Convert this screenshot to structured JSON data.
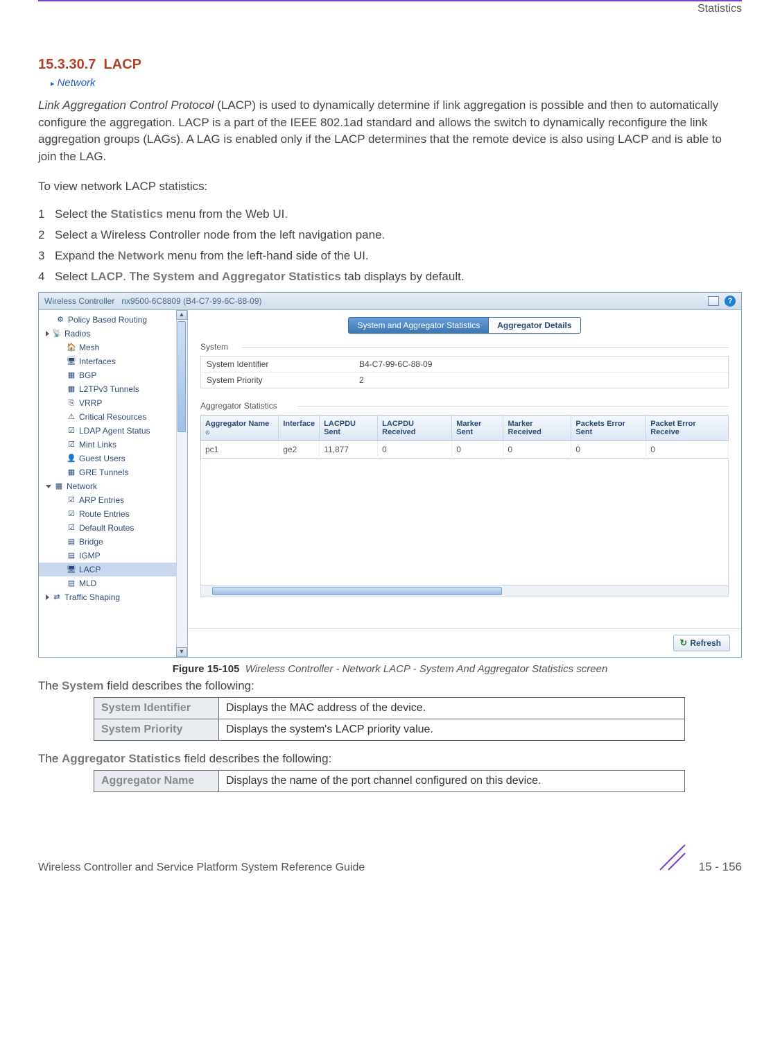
{
  "header": {
    "right": "Statistics"
  },
  "section": {
    "number": "15.3.30.7",
    "title": "LACP",
    "breadcrumb": "Network"
  },
  "intro": {
    "lead_italic": "Link Aggregation Control Protocol",
    "para": " (LACP) is used to dynamically determine if link aggregation is possible and then to automatically configure the aggregation. LACP is a part of the IEEE 802.1ad standard and allows the switch to dynamically reconfigure the link aggregation groups (LAGs). A LAG is enabled only if the LACP determines that the remote device is also using LACP and is able to join the LAG.",
    "to_view": "To view network LACP statistics:"
  },
  "steps": {
    "s1a": "Select the ",
    "s1b": "Statistics",
    "s1c": " menu from the Web UI.",
    "s2": "Select a Wireless Controller node from the left navigation pane.",
    "s3a": "Expand the ",
    "s3b": "Network",
    "s3c": " menu from the left-hand side of the UI.",
    "s4a": "Select ",
    "s4b": "LACP",
    "s4c": ". The ",
    "s4d": "System and Aggregator Statistics",
    "s4e": " tab displays by default."
  },
  "screenshot": {
    "titlebar": {
      "prefix": "Wireless Controller",
      "node": "nx9500-6C8809 (B4-C7-99-6C-88-09)"
    },
    "nav": {
      "items": [
        {
          "t": "Policy Based Routing",
          "ico": "⚙",
          "indent": false
        },
        {
          "t": "Radios",
          "ico": "📡",
          "indent": false,
          "arrow": "right"
        },
        {
          "t": "Mesh",
          "ico": "🏠",
          "indent": true
        },
        {
          "t": "Interfaces",
          "ico": "🖥",
          "indent": true
        },
        {
          "t": "BGP",
          "ico": "▦",
          "indent": true
        },
        {
          "t": "L2TPv3 Tunnels",
          "ico": "▦",
          "indent": true
        },
        {
          "t": "VRRP",
          "ico": "⎘",
          "indent": true
        },
        {
          "t": "Critical Resources",
          "ico": "⚠",
          "indent": true
        },
        {
          "t": "LDAP Agent Status",
          "ico": "☑",
          "indent": true
        },
        {
          "t": "Mint Links",
          "ico": "☑",
          "indent": true
        },
        {
          "t": "Guest Users",
          "ico": "👤",
          "indent": true
        },
        {
          "t": "GRE Tunnels",
          "ico": "▦",
          "indent": true
        },
        {
          "t": "Network",
          "ico": "▦",
          "indent": false,
          "arrow": "down"
        },
        {
          "t": "ARP Entries",
          "ico": "☑",
          "indent": true
        },
        {
          "t": "Route Entries",
          "ico": "☑",
          "indent": true
        },
        {
          "t": "Default Routes",
          "ico": "☑",
          "indent": true
        },
        {
          "t": "Bridge",
          "ico": "▤",
          "indent": true
        },
        {
          "t": "IGMP",
          "ico": "▤",
          "indent": true
        },
        {
          "t": "LACP",
          "ico": "🖥",
          "indent": true,
          "selected": true
        },
        {
          "t": "MLD",
          "ico": "▤",
          "indent": true
        },
        {
          "t": "Traffic Shaping",
          "ico": "⇄",
          "indent": false,
          "arrow": "right"
        }
      ]
    },
    "tabs": {
      "inactive": "System and Aggregator Statistics",
      "active": "Aggregator Details"
    },
    "system": {
      "legend": "System",
      "rows": [
        {
          "k": "System Identifier",
          "v": "B4-C7-99-6C-88-09"
        },
        {
          "k": "System Priority",
          "v": "2"
        }
      ]
    },
    "agg": {
      "legend": "Aggregator Statistics",
      "cols": [
        "Aggregator Name",
        "Interface",
        "LACPDU Sent",
        "LACPDU Received",
        "Marker Sent",
        "Marker Received",
        "Packets Error Sent",
        "Packet Error Receive"
      ],
      "row": [
        "pc1",
        "ge2",
        "11,877",
        "0",
        "0",
        "0",
        "0",
        "0"
      ]
    },
    "refresh": "Refresh"
  },
  "figure": {
    "label": "Figure 15-105",
    "caption": "Wireless Controller - Network LACP - System And Aggregator Statistics screen"
  },
  "desc1a": "The ",
  "desc1b": "System",
  "desc1c": " field describes the following:",
  "table1": {
    "r1k": "System Identifier",
    "r1v": "Displays the MAC address of the device.",
    "r2k": "System Priority",
    "r2v": "Displays the system's LACP priority value."
  },
  "desc2a": "The ",
  "desc2b": "Aggregator Statistics",
  "desc2c": " field describes the following:",
  "table2": {
    "r1k": "Aggregator Name",
    "r1v": "Displays the name of the port channel configured on this device."
  },
  "footer": {
    "guide": "Wireless Controller and Service Platform System Reference Guide",
    "page": "15 - 156"
  }
}
